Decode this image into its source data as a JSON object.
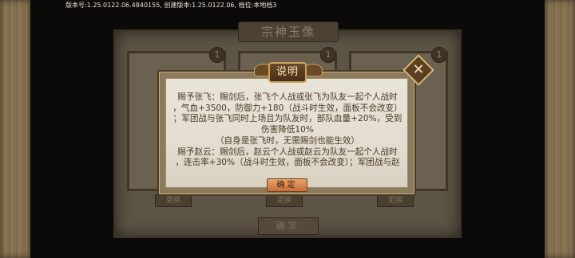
{
  "version_line": "版本号:1.25.0122.06.4840155, 创建版本:1.25.0122.06, 档位:本地档3",
  "background": {
    "title": "宗神玉像",
    "badges": [
      "1",
      "1",
      "1"
    ],
    "card_buttons": [
      "更换",
      "更换",
      "更换"
    ],
    "confirm_label": "确定"
  },
  "dialog": {
    "title": "说明",
    "close_glyph": "✕",
    "lines": [
      "赐予张飞：赐剑后，张飞个人战或张飞为队友一起个人战时",
      "，气血+3500，防御力+180（战斗时生效，面板不会改变）",
      "；军团战与张飞同时上场且为队友时，部队血量+20%，受到",
      "伤害降低10%",
      "（自身是张飞时，无需赐剑也能生效）",
      "赐予赵云：赐剑后，赵云个人战或赵云为队友一起个人战时",
      "，连击率+30%（战斗时生效，面板不会改变）；军团战与赵"
    ],
    "ok_label": "确定"
  }
}
